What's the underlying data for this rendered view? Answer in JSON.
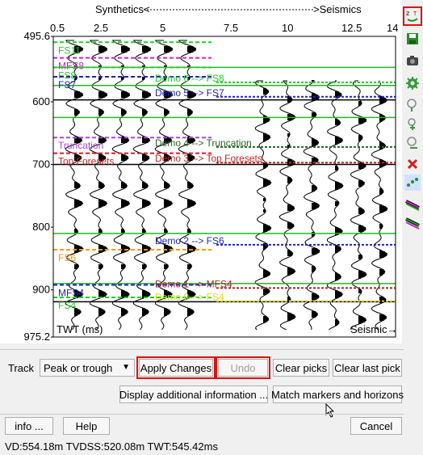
{
  "plot": {
    "header_left": "Synthetics",
    "header_right": "Seismics",
    "x_ticks": [
      "0.5",
      "2.5",
      "5",
      "7.5",
      "10",
      "12.5",
      "14"
    ],
    "y_ticks": [
      "495.6",
      "600",
      "700",
      "800",
      "900",
      "975.2"
    ],
    "y_axis_label": "TWT (ms)",
    "x_axis_label": "Seismic",
    "markers": [
      {
        "label": "FS11",
        "twt": 505,
        "color": "#22cc22",
        "style": "dashed"
      },
      {
        "label": "MFS8",
        "twt": 530,
        "color": "#cc22cc",
        "style": "dashed"
      },
      {
        "label": "FS8",
        "twt": 545,
        "color": "#22cc22",
        "style": "dashed"
      },
      {
        "label": "FS7",
        "twt": 560,
        "color": "#2222cc",
        "style": "dashed"
      },
      {
        "label": "Truncation",
        "twt": 657,
        "color": "#aa44dd",
        "style": "dashed"
      },
      {
        "label": "Top Foresets",
        "twt": 682,
        "color": "#cc2222",
        "style": "dashed"
      },
      {
        "label": "FS6",
        "twt": 836,
        "color": "#ff9900",
        "style": "dashed"
      },
      {
        "label": "MFS4",
        "twt": 892,
        "color": "#2222cc",
        "style": "dashed"
      },
      {
        "label": "FS4",
        "twt": 912,
        "color": "#22cc22",
        "style": "dashed"
      }
    ],
    "demo_picks": [
      {
        "label": "Demo 6 --> FS8",
        "twt": 569,
        "color": "#22cc22"
      },
      {
        "label": "Demo 5 --> FS7",
        "twt": 592,
        "color": "#2222cc"
      },
      {
        "label": "Demo 4 --> Truncation",
        "twt": 672,
        "color": "#226622"
      },
      {
        "label": "Demo 3 --> Top Foresets",
        "twt": 697,
        "color": "#cc2222"
      },
      {
        "label": "Demo 2 --> FS6",
        "twt": 828,
        "color": "#2222cc"
      },
      {
        "label": "Demo 1 --> MFS4",
        "twt": 897,
        "color": "#aa2222"
      },
      {
        "label": "Demo 0 --> FS4",
        "twt": 918,
        "color": "#dddd22"
      }
    ]
  },
  "track": {
    "label": "Track",
    "value": "Peak or trough"
  },
  "buttons": {
    "apply": "Apply Changes",
    "undo": "Undo",
    "clear_picks": "Clear picks",
    "clear_last_pick": "Clear last pick",
    "display_info": "Display additional information ...",
    "match": "Match markers and horizons",
    "info": "info ...",
    "help": "Help",
    "cancel": "Cancel"
  },
  "status": "VD:554.18m  TVDSS:520.08m  TWT:545.42ms",
  "toolbar_icons": [
    "zoom-toggle-icon",
    "save-icon",
    "camera-icon",
    "settings-gear-icon",
    "zoom-in-icon",
    "zoom-out-icon",
    "zoom-reset-icon",
    "delete-icon",
    "scatter-icon",
    "wiggle-color-icon",
    "wiggle-color2-icon"
  ]
}
